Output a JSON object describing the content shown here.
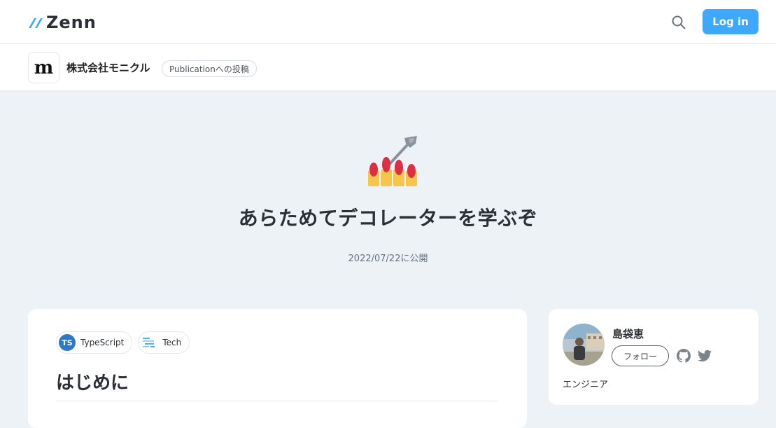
{
  "header": {
    "logo_text": "Zenn",
    "login_label": "Log in",
    "accent_color": "#3ea8ff"
  },
  "publication": {
    "logo_letter": "m",
    "name": "株式会社モニクル",
    "badge": "Publicationへの投稿"
  },
  "article": {
    "emoji": "nail-polish-emoji",
    "title": "あらためてデコレーターを学ぶぞ",
    "published": "2022/07/22に公開",
    "topics": [
      {
        "label": "TypeScript",
        "icon_text": "TS",
        "icon": "typescript-icon"
      },
      {
        "label": "Tech",
        "icon": "tech-icon"
      }
    ],
    "first_heading": "はじめに"
  },
  "author": {
    "name": "島袋恵",
    "follow_label": "フォロー",
    "bio": "エンジニア"
  }
}
